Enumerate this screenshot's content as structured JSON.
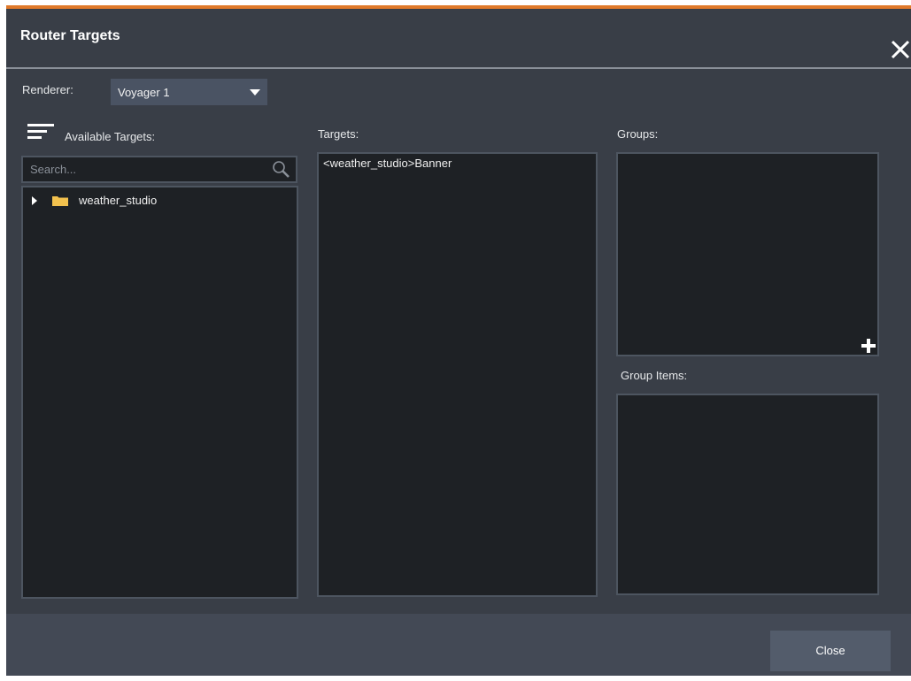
{
  "dialog": {
    "title": "Router Targets",
    "accent_color": "#e0792a",
    "close_icon": "close-icon"
  },
  "renderer": {
    "label": "Renderer:",
    "selected": "Voyager 1"
  },
  "available": {
    "label": "Available Targets:",
    "menu_icon": "hamburger-menu-icon",
    "search_placeholder": "Search...",
    "tree": [
      {
        "label": "weather_studio",
        "icon": "folder-icon",
        "expanded": false
      }
    ]
  },
  "targets": {
    "label": "Targets:",
    "items": [
      "<weather_studio>Banner"
    ]
  },
  "groups": {
    "label": "Groups:",
    "add_icon": "plus-icon"
  },
  "group_items": {
    "label": "Group Items:"
  },
  "footer": {
    "close_label": "Close"
  }
}
